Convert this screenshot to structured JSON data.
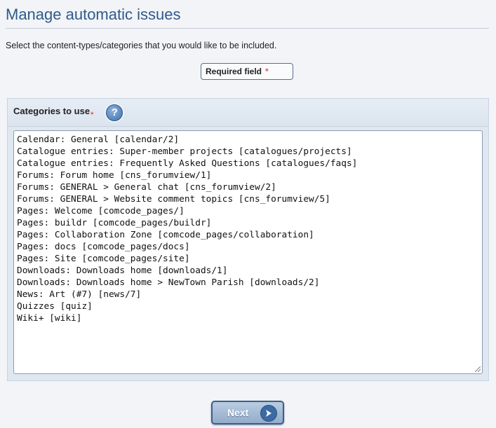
{
  "header": {
    "title": "Manage automatic issues",
    "intro": "Select the content-types/categories that you would like to be included."
  },
  "legend": {
    "required_label": "Required field",
    "required_marker": "*"
  },
  "field": {
    "label": "Categories to use",
    "required_marker": "*",
    "help_icon": "question-icon",
    "options": [
      "Calendar: General [calendar/2]",
      "Catalogue entries: Super-member projects [catalogues/projects]",
      "Catalogue entries: Frequently Asked Questions [catalogues/faqs]",
      "Forums: Forum home [cns_forumview/1]",
      "Forums: GENERAL > General chat [cns_forumview/2]",
      "Forums: GENERAL > Website comment topics [cns_forumview/5]",
      "Pages: Welcome [comcode_pages/]",
      "Pages: buildr [comcode_pages/buildr]",
      "Pages: Collaboration Zone [comcode_pages/collaboration]",
      "Pages: docs [comcode_pages/docs]",
      "Pages: Site [comcode_pages/site]",
      "Downloads: Downloads home [downloads/1]",
      "Downloads: Downloads home > NewTown Parish [downloads/2]",
      "News: Art (#7) [news/7]",
      "Quizzes [quiz]",
      "Wiki+ [wiki]"
    ]
  },
  "actions": {
    "next_label": "Next",
    "next_icon": "arrow-right-icon"
  },
  "colors": {
    "title": "#2f5a8a",
    "required_star": "#e05a5a",
    "panel_bg": "#dfe7f0",
    "button": "#93acc9"
  }
}
